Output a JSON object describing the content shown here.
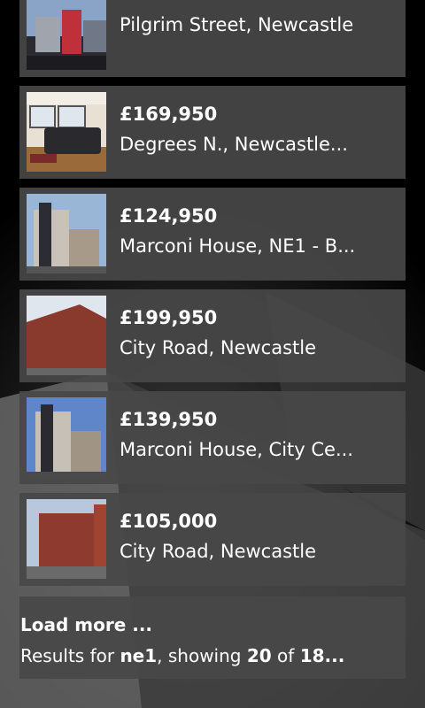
{
  "listings": [
    {
      "price": "",
      "address": "Pilgrim Street, Newcastle",
      "thumb_icon": "street-photo-icon"
    },
    {
      "price": "£169,950",
      "address": "Degrees N., Newcastle...",
      "thumb_icon": "living-room-photo-icon"
    },
    {
      "price": "£124,950",
      "address": "Marconi House, NE1 - B...",
      "thumb_icon": "apartment-building-photo-icon"
    },
    {
      "price": "£199,950",
      "address": "City Road, Newcastle",
      "thumb_icon": "brick-building-photo-icon"
    },
    {
      "price": "£139,950",
      "address": "Marconi House, City Ce...",
      "thumb_icon": "apartment-building-photo-icon"
    },
    {
      "price": "£105,000",
      "address": "City Road, Newcastle",
      "thumb_icon": "brick-building-photo-icon"
    }
  ],
  "load_more": {
    "title": "Load more ...",
    "summary_prefix": "Results for ",
    "query": "ne1",
    "summary_mid": ", showing ",
    "shown": "20",
    "summary_of": " of ",
    "total": "18..."
  },
  "colors": {
    "card_background": "#484848",
    "page_background": "#000000",
    "text": "#ffffff"
  }
}
